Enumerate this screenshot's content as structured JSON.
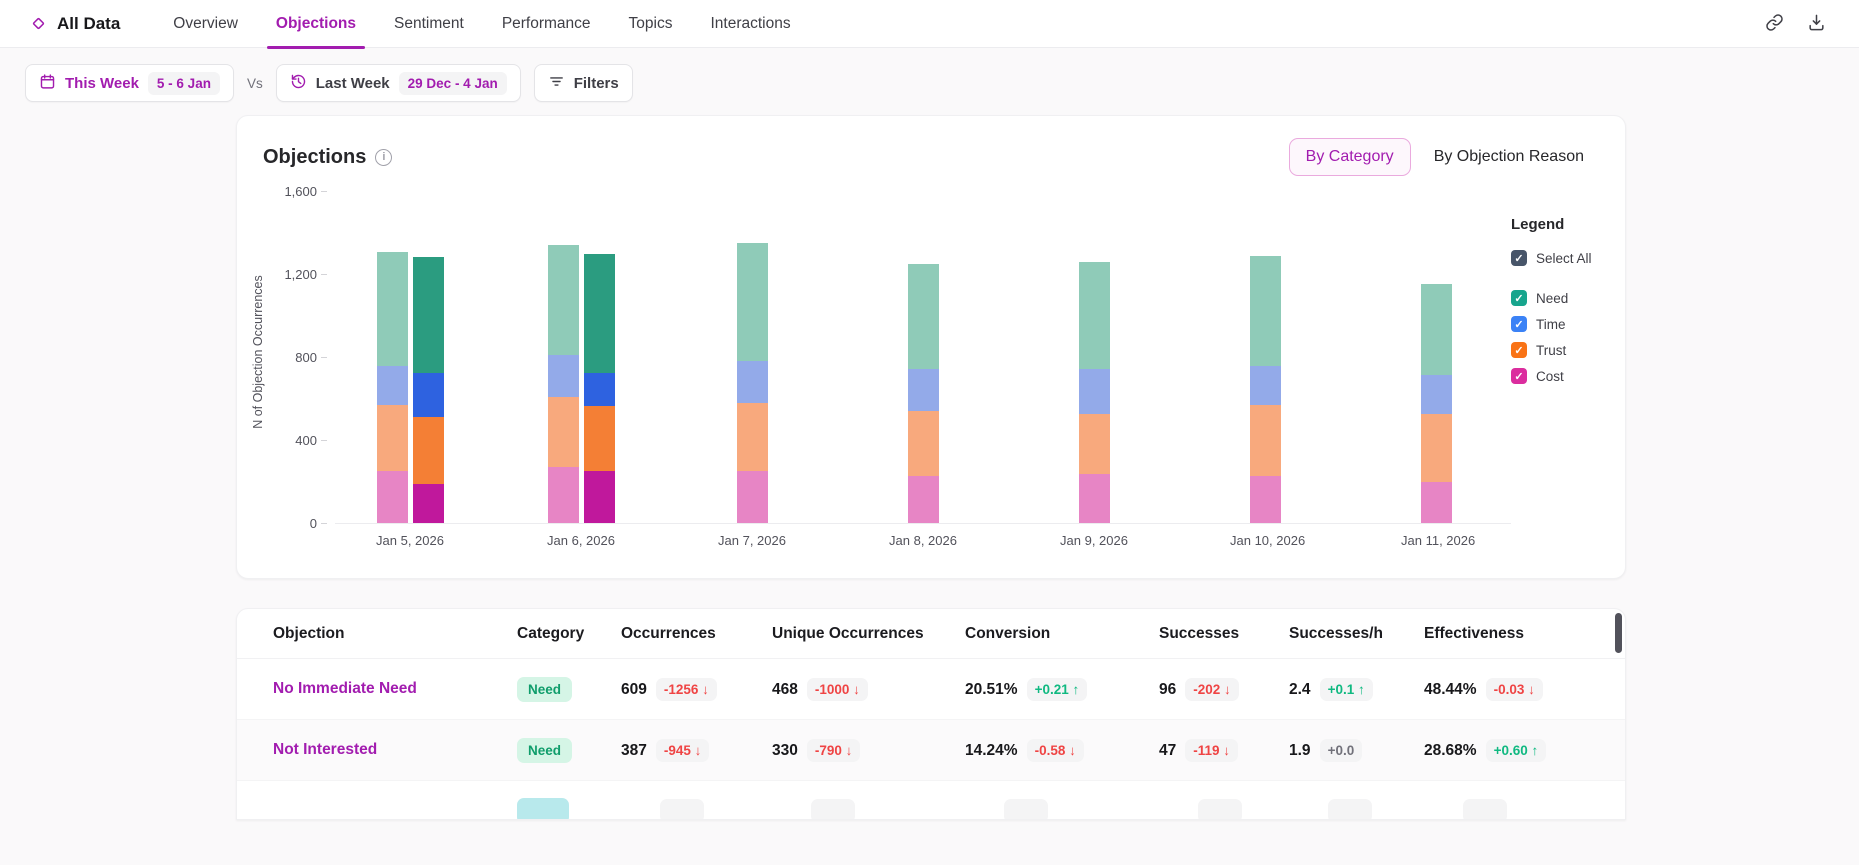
{
  "nav": {
    "brand": "All Data",
    "accent_color": "#a21caf",
    "tabs": [
      {
        "label": "Overview",
        "active": false
      },
      {
        "label": "Objections",
        "active": true
      },
      {
        "label": "Sentiment",
        "active": false
      },
      {
        "label": "Performance",
        "active": false
      },
      {
        "label": "Topics",
        "active": false
      },
      {
        "label": "Interactions",
        "active": false
      }
    ]
  },
  "filter_bar": {
    "primary": {
      "label": "This Week",
      "badge": "5 - 6 Jan"
    },
    "vs": "Vs",
    "comparison": {
      "label": "Last Week",
      "badge": "29 Dec - 4 Jan"
    },
    "filters_button": "Filters"
  },
  "objections_card": {
    "title": "Objections",
    "view_toggle": {
      "options": [
        "By Category",
        "By Objection Reason"
      ],
      "selected": "By Category"
    },
    "legend": {
      "title": "Legend",
      "select_all_label": "Select All",
      "select_all_checked": true,
      "items": [
        {
          "label": "Need",
          "color": "#17a58d",
          "checked": true
        },
        {
          "label": "Time",
          "color": "#3b82f6",
          "checked": true
        },
        {
          "label": "Trust",
          "color": "#f97316",
          "checked": true
        },
        {
          "label": "Cost",
          "color": "#db2d9e",
          "checked": true
        }
      ]
    }
  },
  "chart_data": {
    "type": "bar",
    "stacked": true,
    "title": "Objections",
    "xlabel": "",
    "ylabel": "N of Objection Occurrences",
    "ylim": [
      0,
      1600
    ],
    "ytick_labels": [
      "0",
      "400",
      "800",
      "1,200",
      "1,600"
    ],
    "grid": false,
    "legend_position": "right",
    "categories": [
      "Jan 5, 2026",
      "Jan 6, 2026",
      "Jan 7, 2026",
      "Jan 8, 2026",
      "Jan 9, 2026",
      "Jan 10, 2026",
      "Jan 11, 2026"
    ],
    "stack_order_bottom_to_top": [
      "Cost",
      "Trust",
      "Time",
      "Need"
    ],
    "series": [
      {
        "name": "Cost",
        "period": "Last Week",
        "color": "#e785c5",
        "values": [
          250,
          270,
          250,
          225,
          235,
          225,
          200
        ]
      },
      {
        "name": "Trust",
        "period": "Last Week",
        "color": "#f8a97d",
        "values": [
          320,
          340,
          330,
          315,
          290,
          345,
          325
        ]
      },
      {
        "name": "Time",
        "period": "Last Week",
        "color": "#93aae9",
        "values": [
          185,
          200,
          200,
          200,
          215,
          185,
          190
        ]
      },
      {
        "name": "Need",
        "period": "Last Week",
        "color": "#8fcbb8",
        "values": [
          550,
          530,
          570,
          510,
          520,
          530,
          435
        ]
      },
      {
        "name": "Cost",
        "period": "This Week",
        "color": "#c0189c",
        "values": [
          190,
          250,
          null,
          null,
          null,
          null,
          null
        ]
      },
      {
        "name": "Trust",
        "period": "This Week",
        "color": "#f47f35",
        "values": [
          320,
          315,
          null,
          null,
          null,
          null,
          null
        ]
      },
      {
        "name": "Time",
        "period": "This Week",
        "color": "#2e62e0",
        "values": [
          215,
          160,
          null,
          null,
          null,
          null,
          null
        ]
      },
      {
        "name": "Need",
        "period": "This Week",
        "color": "#2b9c80",
        "values": [
          555,
          570,
          null,
          null,
          null,
          null,
          null
        ]
      }
    ]
  },
  "table": {
    "columns": [
      "Objection",
      "Category",
      "Occurrences",
      "Unique Occurrences",
      "Conversion",
      "Successes",
      "Successes/h",
      "Effectiveness"
    ],
    "rows": [
      {
        "objection": "No Immediate Need",
        "partial": false,
        "category": {
          "label": "Need",
          "bg": "#d5f5e6",
          "fg": "#0f9d6b"
        },
        "metrics": [
          {
            "value": "609",
            "delta": "-1256",
            "dir": "down"
          },
          {
            "value": "468",
            "delta": "-1000",
            "dir": "down"
          },
          {
            "value": "20.51%",
            "delta": "+0.21",
            "dir": "up"
          },
          {
            "value": "96",
            "delta": "-202",
            "dir": "down"
          },
          {
            "value": "2.4",
            "delta": "+0.1",
            "dir": "up"
          },
          {
            "value": "48.44%",
            "delta": "-0.03",
            "dir": "down"
          }
        ]
      },
      {
        "objection": "Not Interested",
        "partial": false,
        "category": {
          "label": "Need",
          "bg": "#d5f5e6",
          "fg": "#0f9d6b"
        },
        "metrics": [
          {
            "value": "387",
            "delta": "-945",
            "dir": "down"
          },
          {
            "value": "330",
            "delta": "-790",
            "dir": "down"
          },
          {
            "value": "14.24%",
            "delta": "-0.58",
            "dir": "down"
          },
          {
            "value": "47",
            "delta": "-119",
            "dir": "down"
          },
          {
            "value": "1.9",
            "delta": "+0.0",
            "dir": "flat"
          },
          {
            "value": "28.68%",
            "delta": "+0.60",
            "dir": "up"
          }
        ]
      },
      {
        "objection": "",
        "partial": true,
        "category": {
          "label": "",
          "bg": "#b8e9ec",
          "fg": "#0e7490"
        },
        "metrics": [
          {
            "value": "",
            "delta": "",
            "dir": "flat"
          },
          {
            "value": "",
            "delta": "",
            "dir": "flat"
          },
          {
            "value": "",
            "delta": "",
            "dir": "flat"
          },
          {
            "value": "",
            "delta": "",
            "dir": "flat"
          },
          {
            "value": "",
            "delta": "",
            "dir": "flat"
          },
          {
            "value": "",
            "delta": "",
            "dir": "flat"
          }
        ]
      }
    ]
  }
}
